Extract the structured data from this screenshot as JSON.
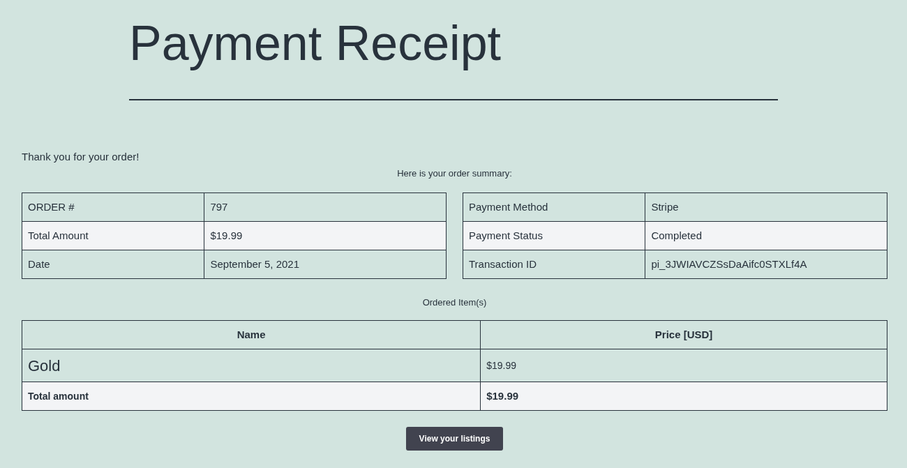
{
  "title": "Payment Receipt",
  "intro": "Thank you for your order!",
  "summary_caption": "Here is your order summary:",
  "order_details": [
    {
      "label": "ORDER #",
      "value": "797"
    },
    {
      "label": "Total Amount",
      "value": "$19.99"
    },
    {
      "label": "Date",
      "value": "September 5, 2021"
    }
  ],
  "payment_details": [
    {
      "label": "Payment Method",
      "value": "Stripe"
    },
    {
      "label": "Payment Status",
      "value": "Completed"
    },
    {
      "label": "Transaction ID",
      "value": "pi_3JWIAVCZSsDaAifc0STXLf4A"
    }
  ],
  "items_caption": "Ordered Item(s)",
  "items_table": {
    "columns": [
      "Name",
      "Price [USD]"
    ],
    "rows": [
      {
        "name": "Gold",
        "price": "$19.99"
      }
    ],
    "total": {
      "label": "Total amount",
      "value": "$19.99"
    }
  },
  "button": "View your listings"
}
